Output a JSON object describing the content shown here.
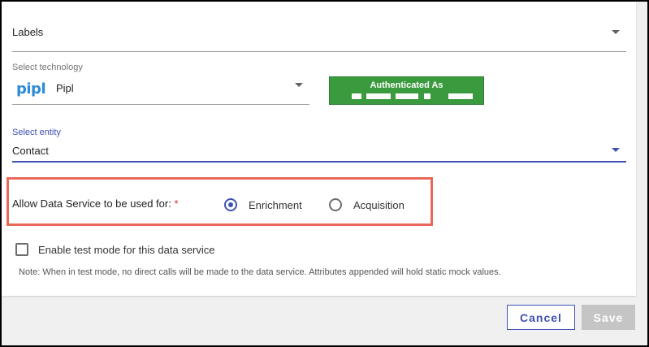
{
  "labels_field": {
    "value": "Labels"
  },
  "technology": {
    "label": "Select technology",
    "logo_text": "pipl",
    "value": "Pipl"
  },
  "auth_badge": {
    "title": "Authenticated As",
    "color": "#3a9a3e"
  },
  "entity": {
    "label": "Select entity",
    "value": "Contact"
  },
  "usage": {
    "label": "Allow Data Service to be used for:",
    "required_mark": "*",
    "options": [
      {
        "label": "Enrichment",
        "selected": true
      },
      {
        "label": "Acquisition",
        "selected": false
      }
    ]
  },
  "test_mode": {
    "label": "Enable test mode for this data service",
    "checked": false,
    "note": "Note: When in test mode, no direct calls will be made to the data service. Attributes appended will hold static mock values."
  },
  "actions": {
    "cancel_label": "Cancel",
    "save_label": "Save"
  },
  "colors": {
    "accent": "#3f51b5",
    "highlight": "#e8695a",
    "required": "#d32f2f"
  }
}
